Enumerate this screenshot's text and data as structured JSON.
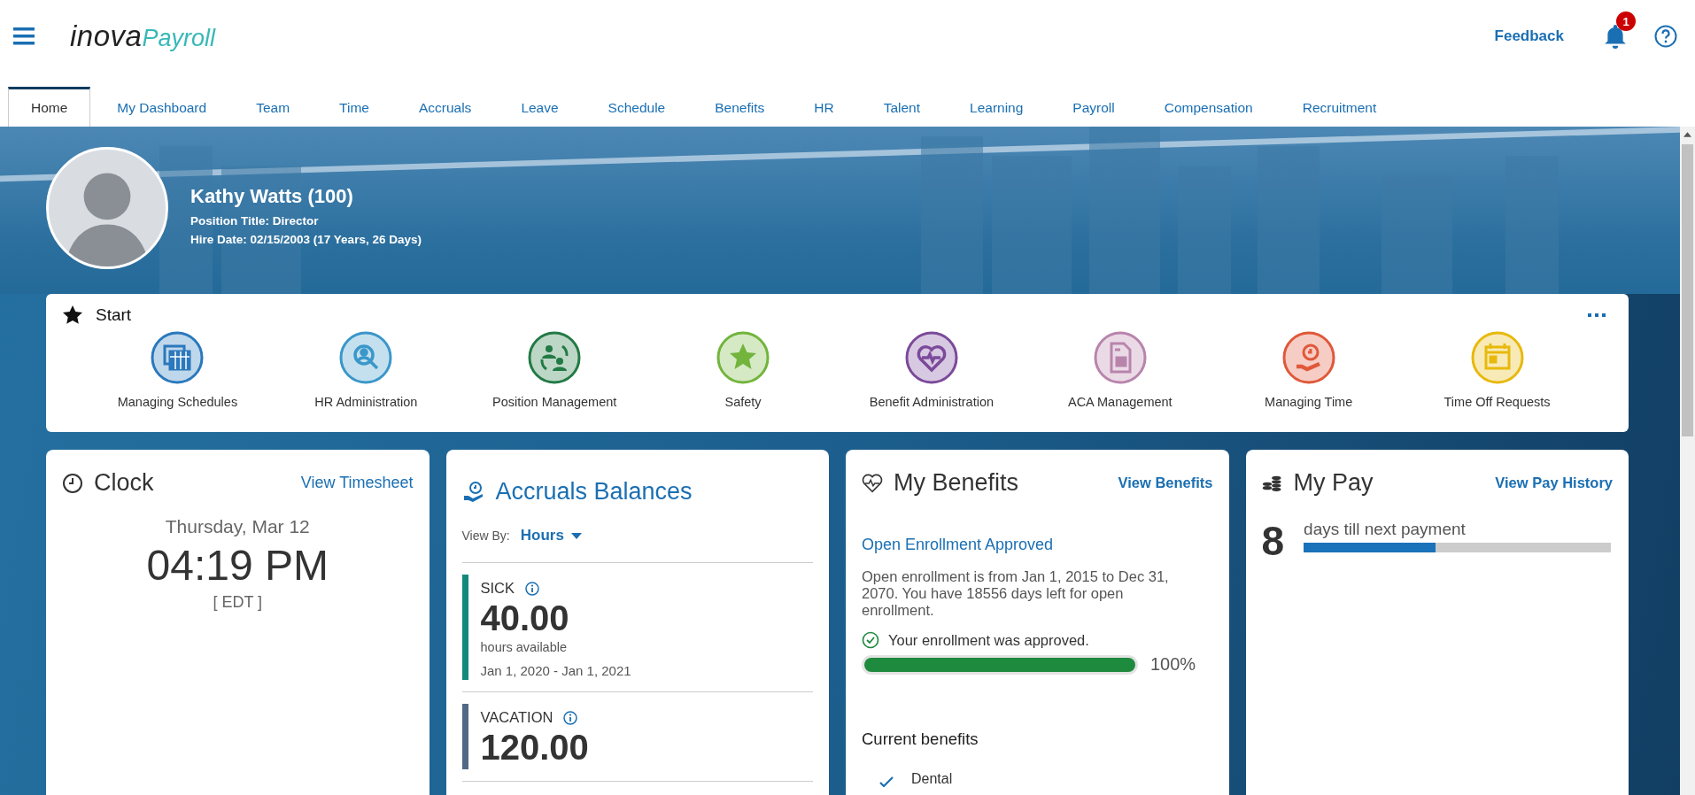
{
  "header": {
    "logo": {
      "brand": "inova",
      "product": "Payroll"
    },
    "feedback": "Feedback",
    "notifications": {
      "count": "1"
    }
  },
  "tabs": [
    {
      "label": "Home",
      "selected": true
    },
    {
      "label": "My Dashboard",
      "selected": false
    },
    {
      "label": "Team",
      "selected": false
    },
    {
      "label": "Time",
      "selected": false
    },
    {
      "label": "Accruals",
      "selected": false
    },
    {
      "label": "Leave",
      "selected": false
    },
    {
      "label": "Schedule",
      "selected": false
    },
    {
      "label": "Benefits",
      "selected": false
    },
    {
      "label": "HR",
      "selected": false
    },
    {
      "label": "Talent",
      "selected": false
    },
    {
      "label": "Learning",
      "selected": false
    },
    {
      "label": "Payroll",
      "selected": false
    },
    {
      "label": "Compensation",
      "selected": false
    },
    {
      "label": "Recruitment",
      "selected": false
    }
  ],
  "profile": {
    "name": "Kathy Watts (100)",
    "position": "Position Title: Director",
    "hire_date": "Hire Date: 02/15/2003 (17 Years, 26 Days)"
  },
  "start": {
    "title": "Start",
    "items": [
      {
        "label": "Managing Schedules",
        "kind": "calendar",
        "color": "#2b78bd"
      },
      {
        "label": "HR Administration",
        "kind": "search",
        "color": "#3a97c9"
      },
      {
        "label": "Position Management",
        "kind": "people",
        "color": "#227a45"
      },
      {
        "label": "Safety",
        "kind": "star",
        "color": "#72b43c"
      },
      {
        "label": "Benefit Administration",
        "kind": "heart",
        "color": "#7b4a9a"
      },
      {
        "label": "ACA Management",
        "kind": "document",
        "color": "#b884ac"
      },
      {
        "label": "Managing Time",
        "kind": "clock",
        "color": "#e0583a"
      },
      {
        "label": "Time Off Requests",
        "kind": "calendar2",
        "color": "#e8b90c"
      }
    ]
  },
  "clock": {
    "title": "Clock",
    "link": "View Timesheet",
    "date": "Thursday, Mar 12",
    "time": "04:19 PM",
    "zone": "[ EDT ]"
  },
  "accruals": {
    "title": "Accruals Balances",
    "view_by_label": "View By:",
    "view_by_value": "Hours",
    "balances": [
      {
        "name": "SICK",
        "amount": "40.00",
        "unit": "hours available",
        "period": "Jan 1, 2020 - Jan 1, 2021",
        "color": "#12897b"
      },
      {
        "name": "VACATION",
        "amount": "120.00",
        "color": "#4e6a86"
      }
    ]
  },
  "benefits": {
    "title": "My Benefits",
    "link": "View Benefits",
    "status": "Open Enrollment Approved",
    "description": "Open enrollment is from Jan 1, 2015 to Dec 31, 2070. You have 18556 days left for open enrollment.",
    "approval": "Your enrollment was approved.",
    "progress": {
      "level": 1,
      "reading": "100%"
    },
    "current_title": "Current benefits",
    "current": [
      {
        "name": "Dental"
      }
    ]
  },
  "pay": {
    "title": "My Pay",
    "link": "View Pay History",
    "days": "8",
    "days_label": "days till next payment",
    "progress": {
      "level": 0.43
    }
  }
}
